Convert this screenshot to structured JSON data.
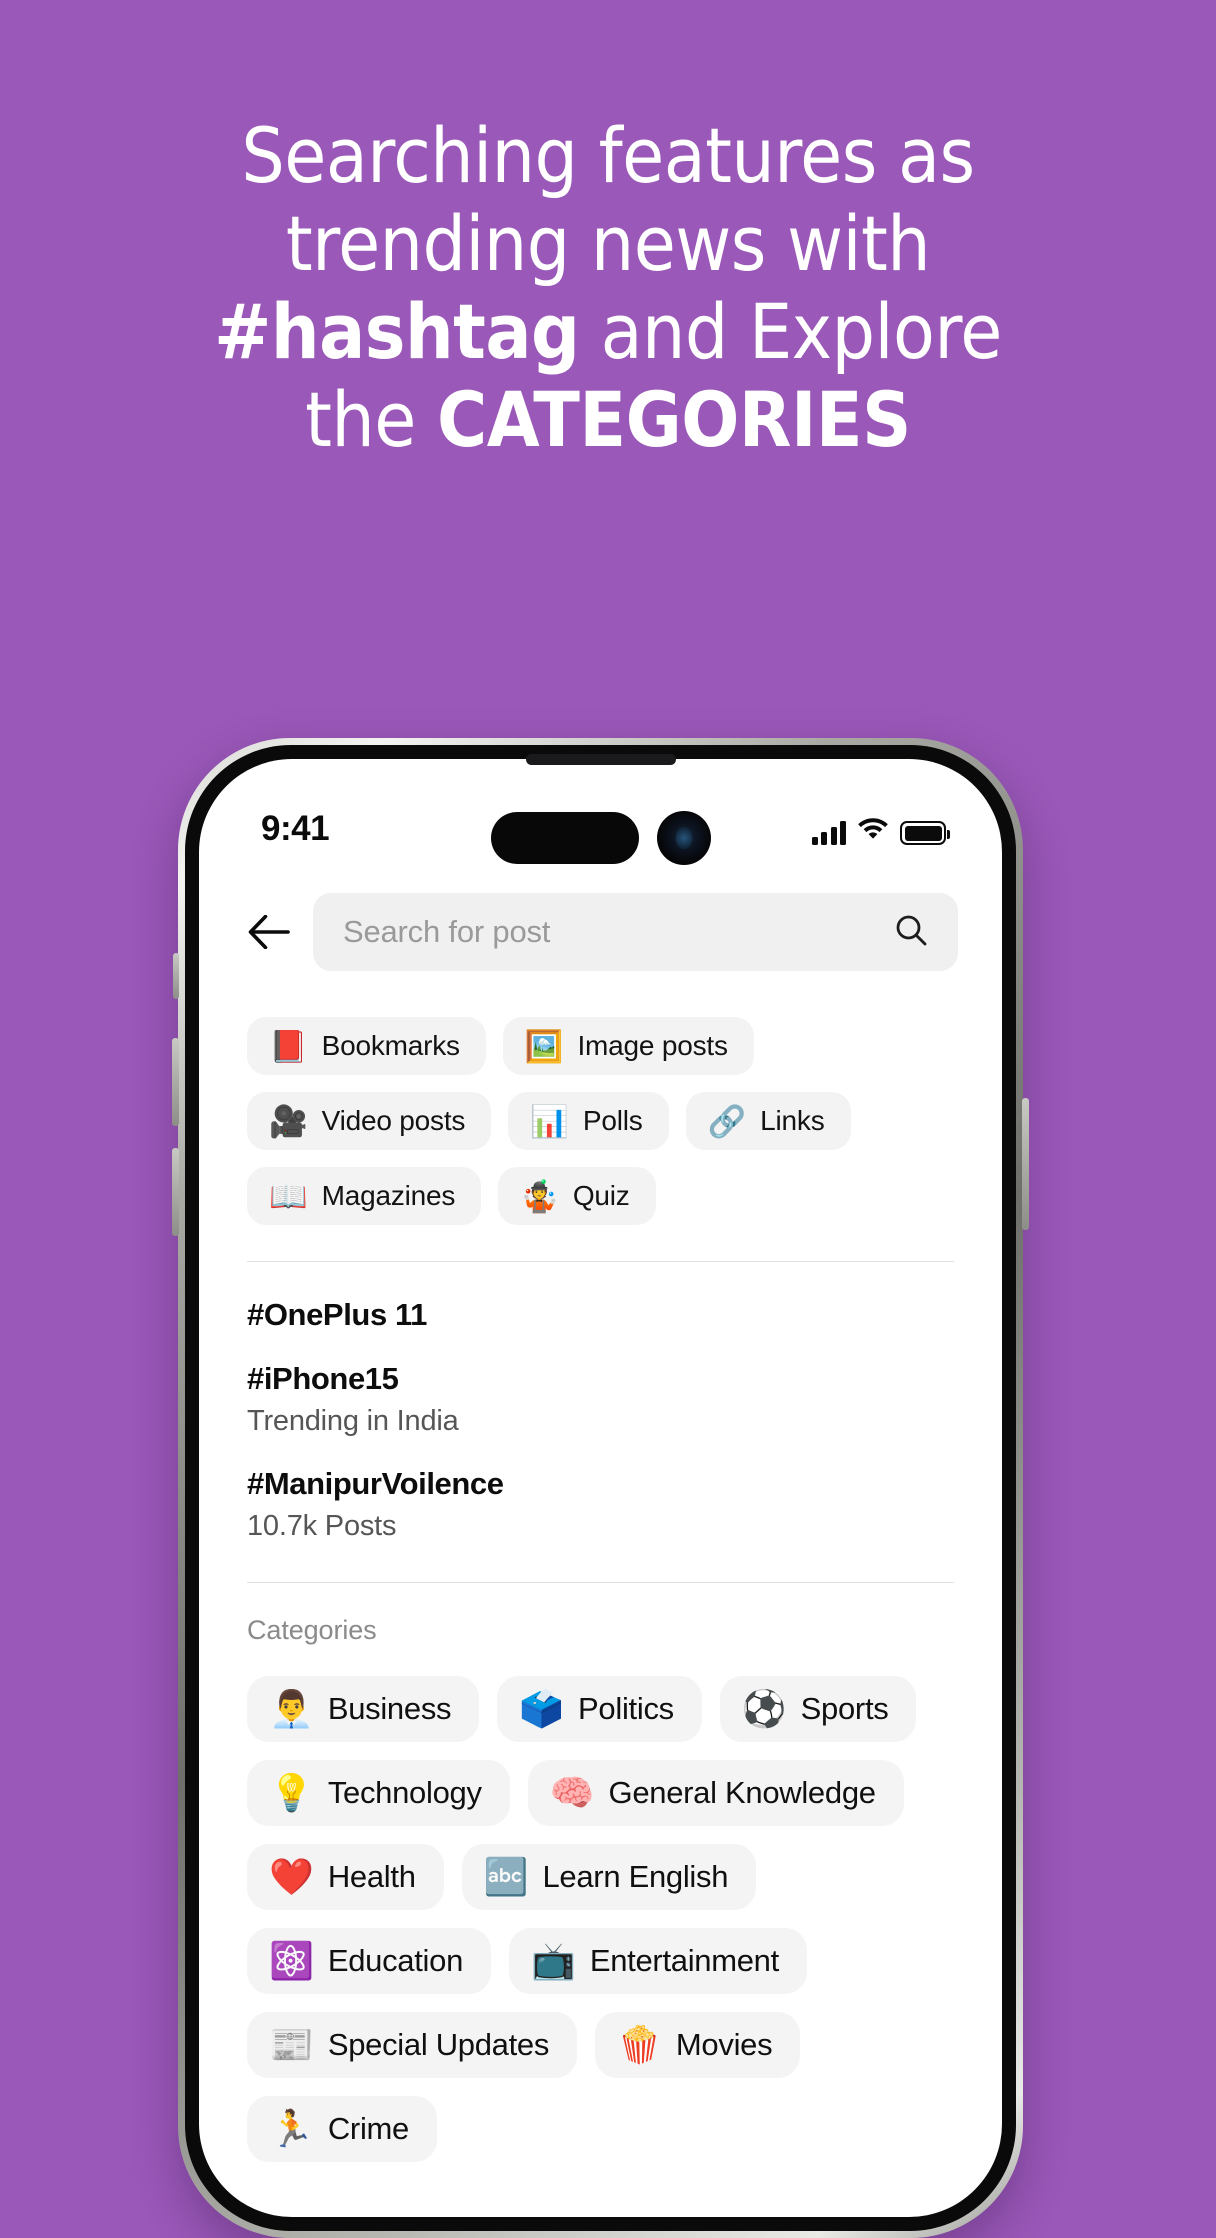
{
  "theme": {
    "background": "#9a58b8",
    "screen_bg": "#ffffff",
    "chip_bg": "#f3f3f3",
    "text_primary": "#0d0d0d",
    "text_muted": "#8a8a8a"
  },
  "headline": {
    "line1": "Searching features as",
    "line2": "trending news with",
    "line3_bold": "#hashtag",
    "line3_rest": " and Explore",
    "line4_rest": "the ",
    "line4_bold": "CATEGORIES"
  },
  "status_bar": {
    "time": "9:41",
    "cellular_icon": "signal-bars-icon",
    "wifi_icon": "wifi-icon",
    "battery_icon": "battery-full-icon"
  },
  "search": {
    "back_icon": "back-arrow-icon",
    "placeholder": "Search for post",
    "value": "",
    "search_icon": "search-icon"
  },
  "filters": [
    {
      "emoji": "📕",
      "label": "Bookmarks",
      "icon_name": "bookmarks-icon"
    },
    {
      "emoji": "🖼️",
      "label": "Image posts",
      "icon_name": "image-posts-icon"
    },
    {
      "emoji": "🎥",
      "label": "Video posts",
      "icon_name": "video-posts-icon"
    },
    {
      "emoji": "📊",
      "label": "Polls",
      "icon_name": "polls-icon"
    },
    {
      "emoji": "🔗",
      "label": "Links",
      "icon_name": "links-icon"
    },
    {
      "emoji": "📖",
      "label": "Magazines",
      "icon_name": "magazines-icon"
    },
    {
      "emoji": "🤹",
      "label": "Quiz",
      "icon_name": "quiz-icon"
    }
  ],
  "trending": [
    {
      "tag": "#OnePlus 11",
      "sub": ""
    },
    {
      "tag": "#iPhone15",
      "sub": "Trending in India"
    },
    {
      "tag": "#ManipurVoilence",
      "sub": "10.7k Posts"
    }
  ],
  "categories_section": {
    "title": "Categories",
    "items": [
      {
        "emoji": "👨‍💼",
        "label": "Business",
        "icon_name": "business-icon"
      },
      {
        "emoji": "🗳️",
        "label": "Politics",
        "icon_name": "politics-icon"
      },
      {
        "emoji": "⚽",
        "label": "Sports",
        "icon_name": "sports-icon"
      },
      {
        "emoji": "💡",
        "label": "Technology",
        "icon_name": "technology-icon"
      },
      {
        "emoji": "🧠",
        "label": "General Knowledge",
        "icon_name": "general-knowledge-icon"
      },
      {
        "emoji": "❤️",
        "label": "Health",
        "icon_name": "health-icon"
      },
      {
        "emoji": "🔤",
        "label": "Learn English",
        "icon_name": "learn-english-icon"
      },
      {
        "emoji": "⚛️",
        "label": "Education",
        "icon_name": "education-icon"
      },
      {
        "emoji": "📺",
        "label": "Entertainment",
        "icon_name": "entertainment-icon"
      },
      {
        "emoji": "📰",
        "label": "Special Updates",
        "icon_name": "special-updates-icon"
      },
      {
        "emoji": "🍿",
        "label": "Movies",
        "icon_name": "movies-icon"
      },
      {
        "emoji": "🏃",
        "label": "Crime",
        "icon_name": "crime-icon"
      }
    ]
  }
}
